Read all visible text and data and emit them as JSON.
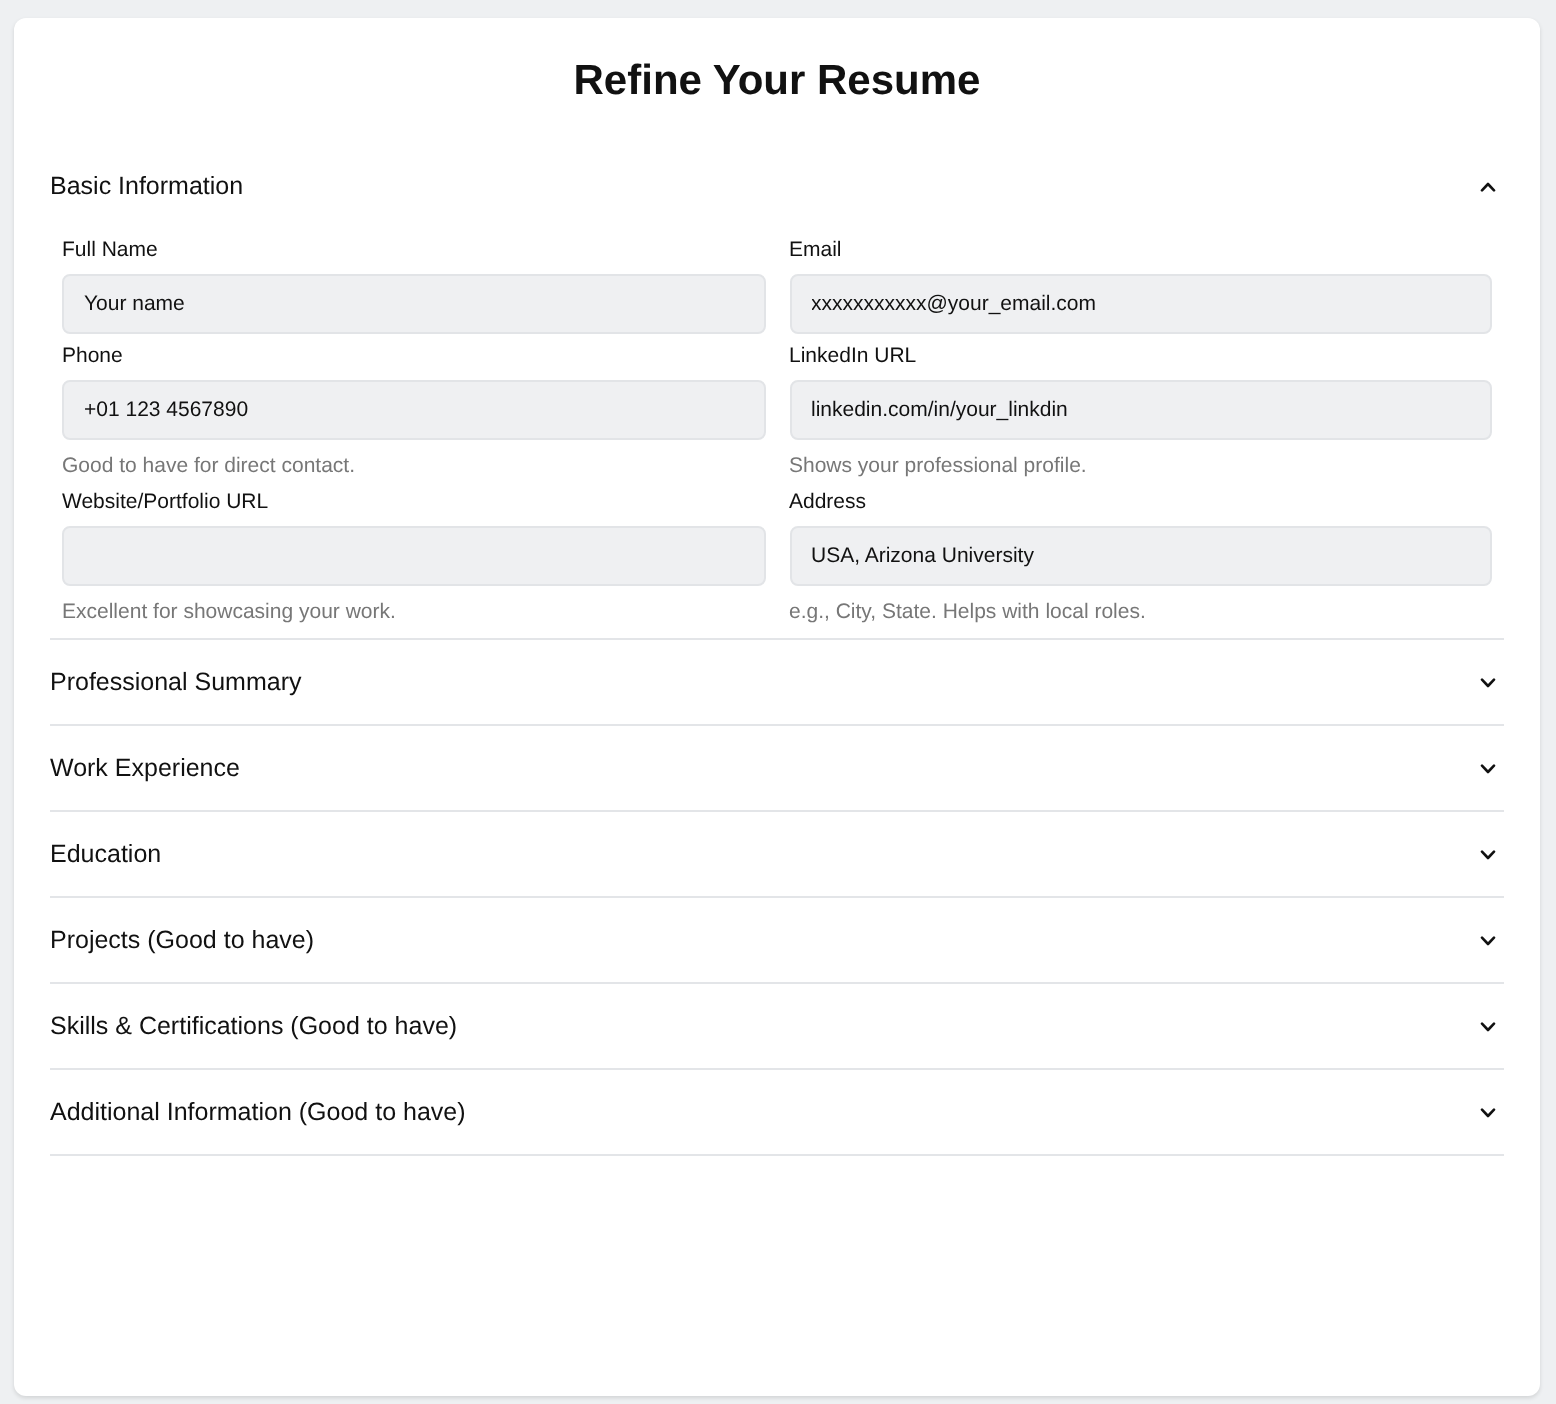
{
  "title": "Refine Your Resume",
  "sections": [
    {
      "title": "Basic Information",
      "expanded": true,
      "fields": [
        {
          "label": "Full Name",
          "value": "Your name"
        },
        {
          "label": "Email",
          "value": "xxxxxxxxxxx@your_email.com"
        },
        {
          "label": "Phone",
          "value": "+01 123 4567890",
          "hint": "Good to have for direct contact."
        },
        {
          "label": "LinkedIn URL",
          "value": "linkedin.com/in/your_linkdin",
          "hint": "Shows your professional profile."
        },
        {
          "label": "Website/Portfolio URL",
          "hint": "Excellent for showcasing your work."
        },
        {
          "label": "Address",
          "value": "USA, Arizona University",
          "hint": "e.g., City, State. Helps with local roles."
        }
      ]
    },
    {
      "title": "Professional Summary",
      "expanded": false
    },
    {
      "title": "Work Experience",
      "expanded": false
    },
    {
      "title": "Education",
      "expanded": false
    },
    {
      "title": "Projects (Good to have)",
      "expanded": false
    },
    {
      "title": "Skills & Certifications (Good to have)",
      "expanded": false
    },
    {
      "title": "Additional Information (Good to have)",
      "expanded": false
    }
  ]
}
